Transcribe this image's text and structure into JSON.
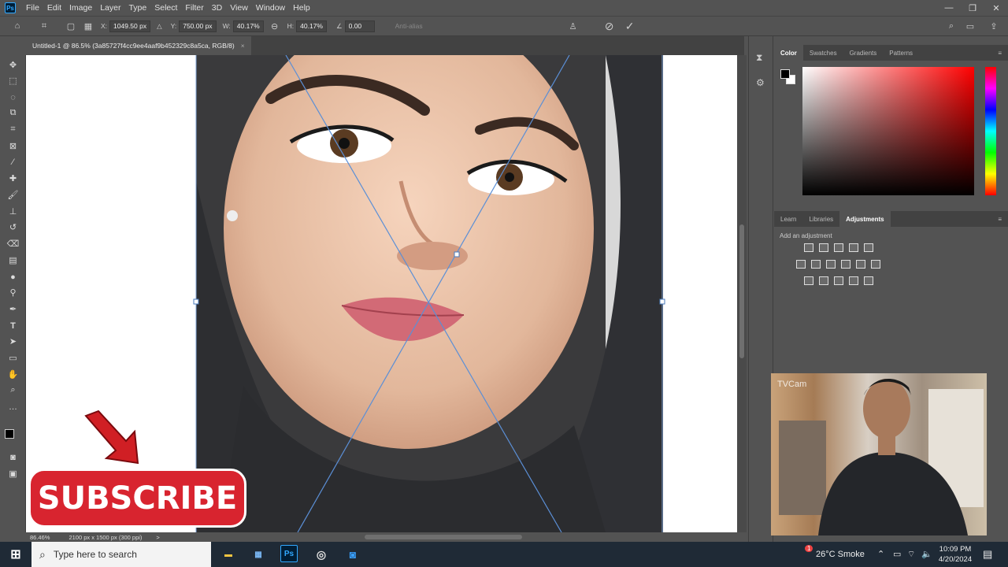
{
  "app": {
    "name": "Ps"
  },
  "menu": [
    "File",
    "Edit",
    "Image",
    "Layer",
    "Type",
    "Select",
    "Filter",
    "3D",
    "View",
    "Window",
    "Help"
  ],
  "options": {
    "x_label": "X:",
    "x_value": "1049.50 px",
    "y_label": "Y:",
    "y_value": "750.00 px",
    "w_label": "W:",
    "w_value": "40.17%",
    "h_label": "H:",
    "h_value": "40.17%",
    "angle_value": "0.00",
    "antialias_label": "Anti-alias"
  },
  "document": {
    "tab_title": "Untitled-1 @ 86.5% (3a85727f4cc9ee4aaf9b452329c8a5ca, RGB/8)",
    "close": "×"
  },
  "status": {
    "zoom": "86.46%",
    "size": "2100 px x 1500 px (300 ppi)",
    "arrow": ">"
  },
  "panels": {
    "top_tabs": [
      "Color",
      "Swatches",
      "Gradients",
      "Patterns"
    ],
    "bottom_tabs": [
      "Learn",
      "Libraries",
      "Adjustments"
    ],
    "adjustments_label": "Add an adjustment"
  },
  "overlays": {
    "subscribe": "SUBSCRIBE",
    "webcam_watermark": "TVCam"
  },
  "taskbar": {
    "search_placeholder": "Type here to search",
    "weather": "26°C  Smoke",
    "weather_badge": "1",
    "time": "10:09 PM",
    "date": "4/20/2024"
  },
  "colors": {
    "accent": "#31a8ff",
    "subscribe_red": "#d8242f",
    "taskbar": "#1f2a36"
  }
}
